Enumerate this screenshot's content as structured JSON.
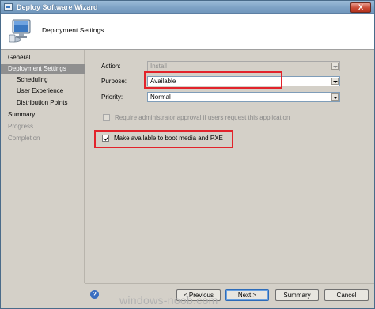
{
  "window": {
    "title": "Deploy Software Wizard",
    "close_label": "X"
  },
  "header": {
    "heading": "Deployment Settings",
    "icon": "computer-monitor-icon"
  },
  "sidebar": {
    "items": [
      {
        "label": "General",
        "state": "normal"
      },
      {
        "label": "Deployment Settings",
        "state": "selected"
      },
      {
        "label": "Scheduling",
        "state": "normal"
      },
      {
        "label": "User Experience",
        "state": "normal"
      },
      {
        "label": "Distribution Points",
        "state": "normal"
      },
      {
        "label": "Summary",
        "state": "normal"
      },
      {
        "label": "Progress",
        "state": "disabled"
      },
      {
        "label": "Completion",
        "state": "disabled"
      }
    ]
  },
  "form": {
    "action_label": "Action:",
    "action_value": "Install",
    "purpose_label": "Purpose:",
    "purpose_value": "Available",
    "priority_label": "Priority:",
    "priority_value": "Normal",
    "require_approval_label": "Require administrator approval if users request this application",
    "require_approval_checked": false,
    "boot_media_label": "Make available to boot media and PXE",
    "boot_media_checked": true
  },
  "footer": {
    "help_label": "?",
    "previous_label": "< Previous",
    "next_label": "Next >",
    "summary_label": "Summary",
    "cancel_label": "Cancel"
  },
  "watermark": {
    "text": "windows-noob.com"
  },
  "colors": {
    "highlight": "#e2232b",
    "selected_nav": "#8f8f8f",
    "titlebar": "#7fa3c6"
  }
}
